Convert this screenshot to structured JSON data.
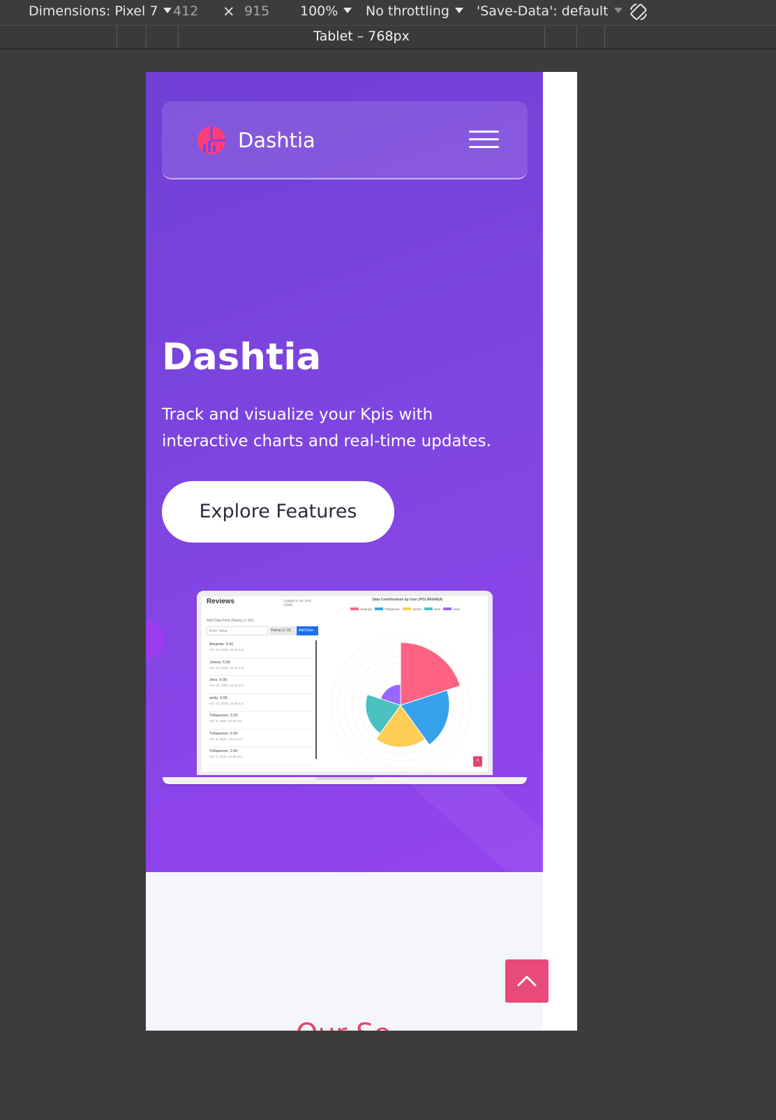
{
  "devtools": {
    "dimensions_label": "Dimensions: Pixel 7",
    "width": "412",
    "times": "×",
    "height": "915",
    "zoom": "100%",
    "throttling": "No throttling",
    "save_data": "'Save-Data': default",
    "media_query_label": "Tablet – 768px"
  },
  "nav": {
    "brand": "Dashtia"
  },
  "hero": {
    "title": "Dashtia",
    "subtitle": "Track and visualize your Kpis with interactive charts and real-time updates.",
    "cta_label": "Explore Features"
  },
  "mockup": {
    "reviews_title": "Reviews",
    "logged_in": "Logged in as Jess (Staff)",
    "add_data_label": "Add Data Point (Rating (1-10))",
    "input_placeholder": "Enter Value",
    "select_value": "Rating (1-10)",
    "add_button": "Add Data",
    "entries": [
      {
        "name": "Amanda: 9.00",
        "date": "Oct. 10, 2025, 11:48 a.m."
      },
      {
        "name": "James: 6.00",
        "date": "Oct. 10, 2025, 11:47 a.m."
      },
      {
        "name": "Jess: 5.00",
        "date": "Oct. 10, 2025, 11:46 a.m."
      },
      {
        "name": "andy: 3.00",
        "date": "Oct. 10, 2025, 11:35 a.m."
      },
      {
        "name": "Trillspectre: 3.00",
        "date": "Oct. 8, 2025, 12:48 a.m."
      },
      {
        "name": "Trillspectre: 2.00",
        "date": "Oct. 8, 2025, 12:34 a.m."
      },
      {
        "name": "Trillspectre: 2.00",
        "date": "Oct. 8, 2025, 12:30 a.m."
      }
    ],
    "chart_title": "Data Contributions by User (POLARAREA)",
    "scroll_top_glyph": "^"
  },
  "chart_data": {
    "type": "polararea",
    "title": "Data Contributions by User (POLARAREA)",
    "categories": [
      "Amanda",
      "Trillspectre",
      "James",
      "Jess",
      "andy"
    ],
    "values": [
      9,
      7,
      6,
      5,
      3
    ],
    "colors": [
      "#ff6384",
      "#36a2eb",
      "#ffcd56",
      "#4bc0c0",
      "#9966ff"
    ],
    "legend_position": "top"
  },
  "features": {
    "heading_peek": "Our Se"
  },
  "colors": {
    "hero_start": "#6f3fd6",
    "hero_end": "#9444ef",
    "accent_pink": "#e74a7b",
    "page_bg": "#f4f6fb"
  },
  "icons": [
    "caret-down-icon",
    "rotate-icon",
    "logo-icon",
    "hamburger-icon",
    "chevron-up-icon"
  ]
}
